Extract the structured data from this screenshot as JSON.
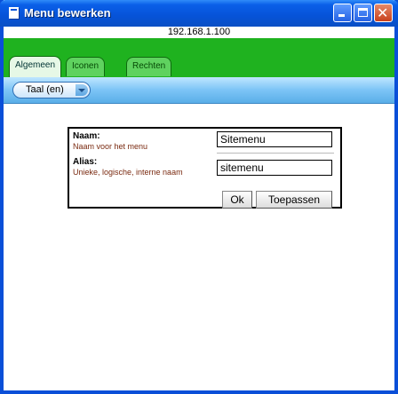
{
  "window": {
    "title": "Menu bewerken"
  },
  "address": "192.168.1.100",
  "tabs": [
    {
      "label": "Algemeen",
      "active": true
    },
    {
      "label": "Iconen",
      "active": false
    },
    {
      "label": "Rechten",
      "active": false
    }
  ],
  "toolbar": {
    "language_label": "Taal (en)"
  },
  "form": {
    "name_label": "Naam:",
    "name_hint": "Naam voor het menu",
    "name_value": "Sitemenu",
    "alias_label": "Alias:",
    "alias_hint": "Unieke, logische, interne naam",
    "alias_value": "sitemenu",
    "ok_label": "Ok",
    "apply_label": "Toepassen"
  },
  "colors": {
    "titlebar": "#0653d8",
    "tabband": "#1fb21f",
    "toolbar": "#7cc4f6"
  }
}
